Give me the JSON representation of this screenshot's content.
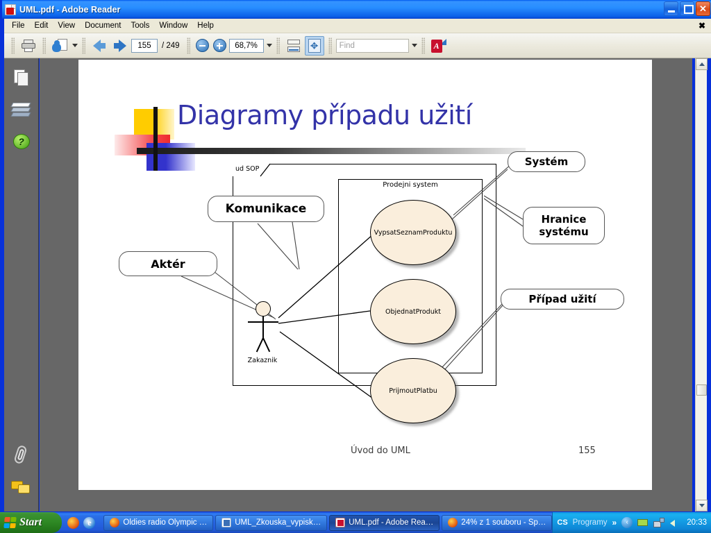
{
  "window": {
    "title": "UML.pdf - Adobe Reader",
    "app_icon": "pdf-document-icon",
    "minimize_label": "Minimize",
    "maximize_label": "Maximize",
    "close_label": "Close"
  },
  "menubar": {
    "items": [
      "File",
      "Edit",
      "View",
      "Document",
      "Tools",
      "Window",
      "Help"
    ],
    "close_glyph": "✖"
  },
  "toolbar": {
    "print_icon": "printer-icon",
    "email_icon": "email-document-icon",
    "prev_page_icon": "arrow-left-icon",
    "next_page_icon": "arrow-right-icon",
    "current_page": "155",
    "page_separator": "/ 249",
    "zoom_out_icon": "zoom-out-icon",
    "zoom_in_icon": "zoom-in-icon",
    "zoom_level": "68,7%",
    "fit_width_icon": "fit-width-icon",
    "fit_page_icon": "fit-page-icon",
    "find_placeholder": "Find",
    "find_value": "",
    "acrobat_icon": "adobe-export-icon"
  },
  "sidebar": {
    "items": [
      {
        "name": "pages-panel",
        "icon": "pages-icon"
      },
      {
        "name": "layers-panel",
        "icon": "layers-icon"
      },
      {
        "name": "help-panel",
        "icon": "help-icon",
        "glyph": "?"
      },
      {
        "name": "attachments-panel",
        "icon": "paperclip-icon"
      },
      {
        "name": "comments-panel",
        "icon": "comments-icon"
      }
    ]
  },
  "slide": {
    "title": "Diagramy případu užití",
    "footer_left": "Úvod do UML",
    "footer_page": "155"
  },
  "diagram": {
    "frame_label": "ud SOP",
    "system_boundary_label": "Prodejni system",
    "actor": {
      "name": "Zakaznik",
      "label": "Zakaznik"
    },
    "use_cases": [
      {
        "id": "u1",
        "label": "VypsatSeznamProduktu"
      },
      {
        "id": "u2",
        "label": "ObjednatProdukt"
      },
      {
        "id": "u3",
        "label": "PrijmoutPlatbu"
      }
    ],
    "callouts": [
      {
        "id": "komunikace",
        "label": "Komunikace"
      },
      {
        "id": "akter",
        "label": "Aktér"
      },
      {
        "id": "system",
        "label": "Systém"
      },
      {
        "id": "hranice",
        "label": "Hranice systému"
      },
      {
        "id": "pripad",
        "label": "Případ užití"
      }
    ],
    "colors": {
      "use_case_fill": "#faeedc",
      "line": "#000000",
      "title": "#3333a8"
    }
  },
  "taskbar": {
    "start_label": "Start",
    "quick_launch": [
      {
        "name": "firefox",
        "icon": "firefox-icon"
      },
      {
        "name": "internet-explorer",
        "icon": "ie-icon",
        "glyph": "e"
      }
    ],
    "tasks": [
      {
        "label": "Oldies radio Olympic …",
        "icon": "firefox-icon",
        "active": false
      },
      {
        "label": "UML_Zkouska_vypisk…",
        "icon": "word-icon",
        "active": false
      },
      {
        "label": "UML.pdf - Adobe Rea…",
        "icon": "pdf-icon",
        "active": true
      },
      {
        "label": "24% z 1 souboru - Sp…",
        "icon": "firefox-icon",
        "active": false
      }
    ],
    "tray": {
      "language": "CS",
      "programs_label": "Programy",
      "chevron": "»",
      "back_glyph": "‹",
      "clock": "20:33"
    }
  }
}
